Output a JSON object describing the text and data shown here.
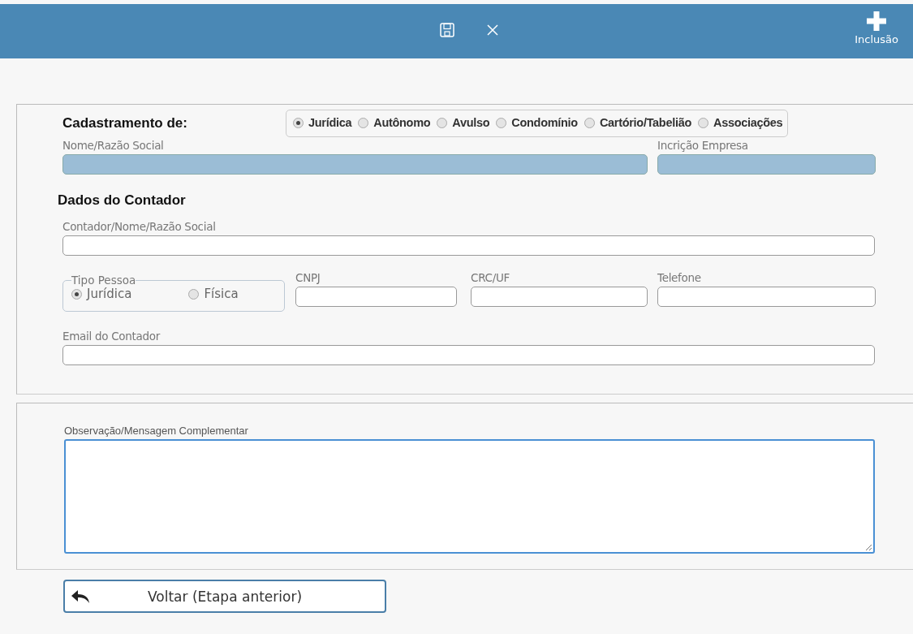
{
  "toolbar": {
    "new_button": {
      "label": "Inclusão"
    }
  },
  "registration": {
    "label": "Cadastramento de:",
    "options": [
      {
        "label": "Jurídica",
        "selected": true
      },
      {
        "label": "Autônomo",
        "selected": false
      },
      {
        "label": "Avulso",
        "selected": false
      },
      {
        "label": "Condomínio",
        "selected": false
      },
      {
        "label": "Cartório/Tabelião",
        "selected": false
      },
      {
        "label": "Associações",
        "selected": false
      }
    ]
  },
  "company_fields": [
    {
      "label": "Nome/Razão Social",
      "disabled": true
    },
    {
      "label": "Incrição Empresa",
      "disabled": true
    }
  ],
  "accountant": {
    "heading": "Dados do Contador",
    "name_field": {
      "label": "Contador/Nome/Razão Social",
      "disabled": false
    },
    "person_type": {
      "legend": "Tipo Pessoa",
      "options": [
        {
          "label": "Jurídica",
          "selected": true
        },
        {
          "label": "Física",
          "selected": false
        }
      ]
    },
    "id_fields": [
      {
        "label": "CNPJ",
        "disabled": false
      },
      {
        "label": "CRC/UF",
        "disabled": false
      },
      {
        "label": "Telefone",
        "disabled": false
      }
    ],
    "email_field": {
      "label": "Email do Contador",
      "disabled": false
    }
  },
  "notes": {
    "label": "Observação/Mensagem Complementar",
    "focused": true
  },
  "back_button": {
    "label": "Voltar (Etapa anterior)"
  }
}
